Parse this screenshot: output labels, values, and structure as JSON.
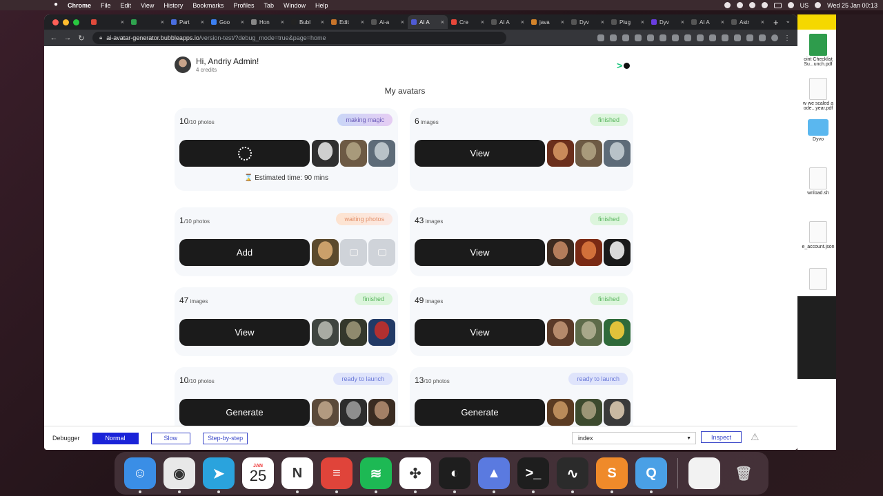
{
  "menubar": {
    "menus": [
      "Chrome",
      "File",
      "Edit",
      "View",
      "History",
      "Bookmarks",
      "Profiles",
      "Tab",
      "Window",
      "Help"
    ],
    "keyboard": "US",
    "datetime": "Wed 25 Jan  00:13"
  },
  "browser": {
    "tabs": [
      {
        "label": "",
        "color": "#e04a3b",
        "active": false
      },
      {
        "label": "",
        "color": "#2fa44f",
        "active": false
      },
      {
        "label": "Part",
        "color": "#4a6ee0",
        "active": false
      },
      {
        "label": "Goo",
        "color": "#3c7ff0",
        "active": false
      },
      {
        "label": "Hon",
        "color": "#888888",
        "active": false
      },
      {
        "label": "Bubl",
        "color": "#222222",
        "active": false
      },
      {
        "label": "Edit",
        "color": "#c8742a",
        "active": false
      },
      {
        "label": "Ai-a",
        "color": "#555555",
        "active": false
      },
      {
        "label": "AI A",
        "color": "#4f5bd5",
        "active": true
      },
      {
        "label": "Cre",
        "color": "#e8473a",
        "active": false
      },
      {
        "label": "AI A",
        "color": "#555555",
        "active": false
      },
      {
        "label": "java",
        "color": "#d4832a",
        "active": false
      },
      {
        "label": "Dyv",
        "color": "#555555",
        "active": false
      },
      {
        "label": "Plug",
        "color": "#555555",
        "active": false
      },
      {
        "label": "Dyv",
        "color": "#6a3de0",
        "active": false
      },
      {
        "label": "AI A",
        "color": "#555555",
        "active": false
      },
      {
        "label": "Astr",
        "color": "#555555",
        "active": false
      }
    ],
    "url_host": "ai-avatar-generator.bubbleapps.io",
    "url_path": "/version-test/?debug_mode=true&page=home"
  },
  "page": {
    "greeting": "Hi, Andriy Admin!",
    "credits": "4 credits",
    "section_title": "My avatars",
    "cards": [
      {
        "count": "10",
        "unit": "/10 photos",
        "badge": "making magic",
        "badge_type": "magic",
        "button": "",
        "spinner": true,
        "estimate": "Estimated time: 90 mins",
        "thumbs": [
          [
            "#2f2f2f",
            "#cfcfcf"
          ],
          [
            "#6d5a44",
            "#a89a7b"
          ],
          [
            "#5d6b78",
            "#b8c2c8"
          ]
        ]
      },
      {
        "count": "6",
        "unit": "images",
        "badge": "finished",
        "badge_type": "finished",
        "button": "View",
        "spinner": false,
        "estimate": "",
        "thumbs": [
          [
            "#6b2f1c",
            "#c98a5a"
          ],
          [
            "#6d5a44",
            "#a89a7b"
          ],
          [
            "#5d6b78",
            "#b8c2c8"
          ]
        ]
      },
      {
        "count": "1",
        "unit": "/10 photos",
        "badge": "waiting photos",
        "badge_type": "waiting",
        "button": "Add",
        "spinner": false,
        "estimate": "",
        "thumbs": [
          [
            "#5b4a2d",
            "#caa06a"
          ],
          [
            "ph"
          ],
          [
            "ph"
          ]
        ]
      },
      {
        "count": "43",
        "unit": "images",
        "badge": "finished",
        "badge_type": "finished",
        "button": "View",
        "spinner": false,
        "estimate": "",
        "thumbs": [
          [
            "#3d2b20",
            "#b47d5b"
          ],
          [
            "#7a2a14",
            "#d2703a"
          ],
          [
            "#1a1a1a",
            "#d9d9d9"
          ]
        ]
      },
      {
        "count": "47",
        "unit": "images",
        "badge": "finished",
        "badge_type": "finished",
        "button": "View",
        "spinner": false,
        "estimate": "",
        "thumbs": [
          [
            "#3f4540",
            "#a8aba3"
          ],
          [
            "#34382c",
            "#8f8a6e"
          ],
          [
            "#223a66",
            "#b23030"
          ]
        ]
      },
      {
        "count": "49",
        "unit": "images",
        "badge": "finished",
        "badge_type": "finished",
        "button": "View",
        "spinner": false,
        "estimate": "",
        "thumbs": [
          [
            "#5a3a28",
            "#b58a6b"
          ],
          [
            "#5e6b4a",
            "#a8a88a"
          ],
          [
            "#2f6a3a",
            "#e0c23a"
          ]
        ]
      },
      {
        "count": "10",
        "unit": "/10 photos",
        "badge": "ready to launch",
        "badge_type": "ready",
        "button": "Generate",
        "spinner": false,
        "estimate": "",
        "thumbs": [
          [
            "#5b4a3a",
            "#b29a80"
          ],
          [
            "#2d2d2d",
            "#8e8e8e"
          ],
          [
            "#3a2c22",
            "#a38066"
          ]
        ]
      },
      {
        "count": "13",
        "unit": "/10 photos",
        "badge": "ready to launch",
        "badge_type": "ready",
        "button": "Generate",
        "spinner": false,
        "estimate": "",
        "thumbs": [
          [
            "#5a3b22",
            "#b98b5a"
          ],
          [
            "#3d4a2e",
            "#9c9576"
          ],
          [
            "#3a3a3a",
            "#c9b9a2"
          ]
        ]
      }
    ]
  },
  "debugger": {
    "label": "Debugger",
    "normal": "Normal",
    "slow": "Slow",
    "step": "Step-by-step",
    "page_select": "index",
    "inspect": "Inspect"
  },
  "finder_files": [
    {
      "name": "oint Checklist Su...unch.pdf",
      "kind": "sheet"
    },
    {
      "name": "w we scaled a ode...year.pdf",
      "kind": "doc"
    },
    {
      "name": "Dyvo",
      "kind": "folder"
    },
    {
      "name": "wnload.sh",
      "kind": "doc"
    },
    {
      "name": "e_account.json",
      "kind": "doc"
    },
    {
      "name": "",
      "kind": "doc"
    }
  ],
  "dock": {
    "calendar_month": "JAN",
    "calendar_day": "25",
    "apps": [
      {
        "name": "finder",
        "color": "#3a8ee6",
        "glyph": "☺"
      },
      {
        "name": "chrome",
        "color": "#e8e8e8",
        "glyph": "◉"
      },
      {
        "name": "telegram",
        "color": "#2aa3dd",
        "glyph": "➤"
      },
      {
        "name": "calendar",
        "color": "#ffffff",
        "glyph": ""
      },
      {
        "name": "notion",
        "color": "#ffffff",
        "glyph": "N"
      },
      {
        "name": "todoist",
        "color": "#e0443a",
        "glyph": "≡"
      },
      {
        "name": "spotify",
        "color": "#1db954",
        "glyph": "≋"
      },
      {
        "name": "slack",
        "color": "#ffffff",
        "glyph": "✣"
      },
      {
        "name": "figma",
        "color": "#1e1e1e",
        "glyph": "◐"
      },
      {
        "name": "paw",
        "color": "#5a7ae0",
        "glyph": "▲"
      },
      {
        "name": "terminal",
        "color": "#1e1e1e",
        "glyph": ">_"
      },
      {
        "name": "activity-monitor",
        "color": "#2b2b2b",
        "glyph": "∿"
      },
      {
        "name": "sublime-text",
        "color": "#ef8a2a",
        "glyph": "S"
      },
      {
        "name": "quicktime",
        "color": "#4aa0e6",
        "glyph": "Q"
      }
    ]
  }
}
